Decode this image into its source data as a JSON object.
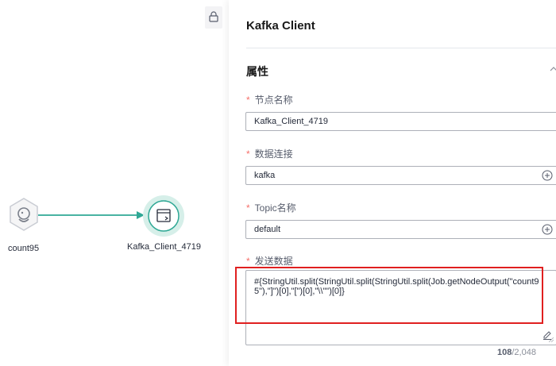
{
  "canvas": {
    "nodes": [
      {
        "label": "count95",
        "icon": "hexagon-node-icon"
      },
      {
        "label": "Kafka_Client_4719",
        "icon": "kafka-client-node-icon",
        "selected": true
      }
    ],
    "lock_icon": "lock-icon"
  },
  "panel": {
    "title": "Kafka Client",
    "section": "属性",
    "fields": {
      "node_name": {
        "label": "节点名称",
        "value": "Kafka_Client_4719"
      },
      "data_connection": {
        "label": "数据连接",
        "value": "kafka"
      },
      "topic": {
        "label": "Topic名称",
        "value": "default"
      },
      "send_data": {
        "label": "发送数据",
        "value": "#{StringUtil.split(StringUtil.split(StringUtil.split(Job.getNodeOutput(\"count95\"),\"]\")[0],\"[\")[0],\"\\\\\"\")[0]}",
        "count": "108",
        "max": "/2,048"
      }
    },
    "required_mark": "*"
  },
  "colors": {
    "accent_teal": "#2fa895",
    "required": "#f66f6a",
    "highlight": "#e02020"
  }
}
